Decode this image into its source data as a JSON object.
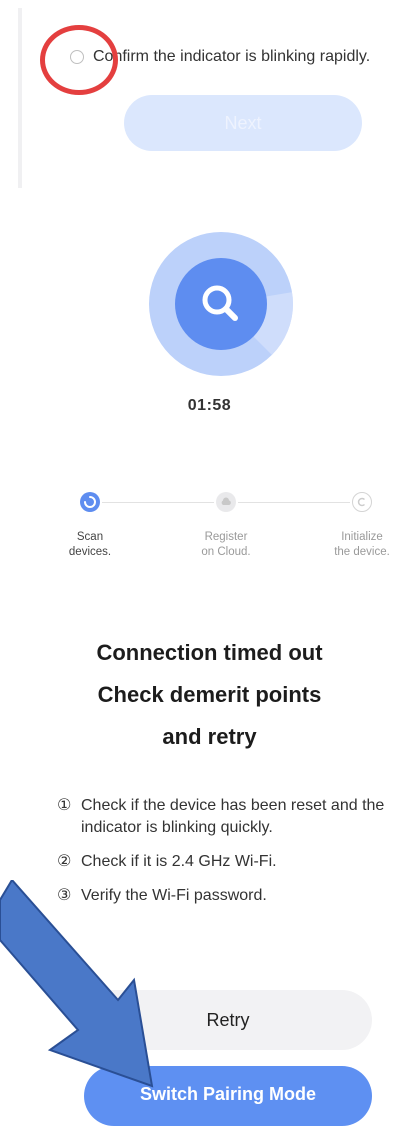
{
  "confirm": {
    "text": "Confirm the indicator is blinking rapidly.",
    "next_label": "Next"
  },
  "scan": {
    "icon": "search-icon",
    "timer": "01:58"
  },
  "steps": [
    {
      "label_line1": "Scan",
      "label_line2": "devices.",
      "state": "active",
      "icon": "loading-icon"
    },
    {
      "label_line1": "Register",
      "label_line2": "on Cloud.",
      "state": "pending",
      "icon": "cloud-icon"
    },
    {
      "label_line1": "Initialize",
      "label_line2": "the device.",
      "state": "pending",
      "icon": "initialize-icon"
    }
  ],
  "status": {
    "line1": "Connection timed out",
    "line2": "Check demerit points",
    "line3": "and retry"
  },
  "tips": [
    {
      "num": "①",
      "text": "Check if the device has been reset and the indicator is blinking quickly."
    },
    {
      "num": "②",
      "text": "Check if it is 2.4 GHz Wi-Fi."
    },
    {
      "num": "③",
      "text": "Verify the Wi-Fi password."
    }
  ],
  "actions": {
    "retry_label": "Retry",
    "switch_label": "Switch Pairing Mode"
  },
  "colors": {
    "accent": "#5e90f2",
    "annotation_red": "#e43f3f",
    "annotation_arrow": "#4a78c8"
  }
}
